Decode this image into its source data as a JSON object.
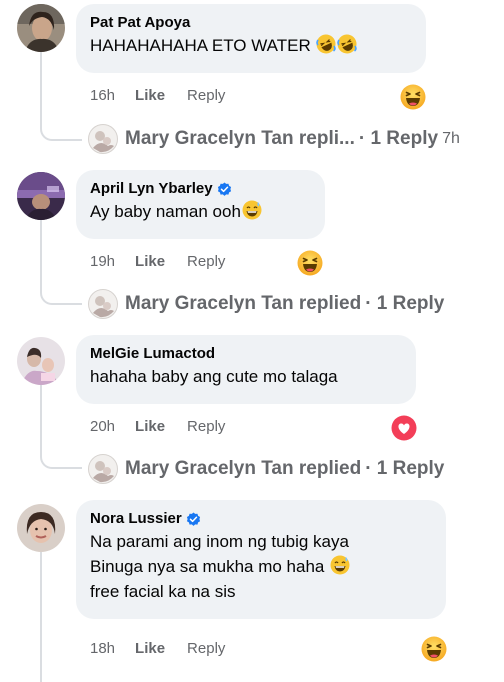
{
  "comments": [
    {
      "author": "Pat Pat Apoya",
      "verified": false,
      "lines": [
        "HAHAHAHAHA ETO WATER"
      ],
      "trailing_emojis": [
        "rofl-emoji",
        "rofl-emoji"
      ],
      "time": "16h",
      "like": "Like",
      "reply": "Reply",
      "reaction": "haha-reaction",
      "replies_text": "Mary Gracelyn Tan repli...",
      "replies_count": "· 1 Reply",
      "replies_time": "7h"
    },
    {
      "author": "April Lyn Ybarley",
      "verified": true,
      "lines": [
        "Ay baby naman ooh"
      ],
      "trailing_emojis": [
        "grin-sweat-emoji"
      ],
      "time": "19h",
      "like": "Like",
      "reply": "Reply",
      "reaction": "haha-reaction",
      "replies_text": "Mary Gracelyn Tan replied",
      "replies_count": "· 1 Reply"
    },
    {
      "author": "MelGie Lumactod",
      "verified": false,
      "lines": [
        "hahaha baby ang cute mo talaga"
      ],
      "trailing_emojis": [],
      "time": "20h",
      "like": "Like",
      "reply": "Reply",
      "reaction": "love-reaction",
      "replies_text": "Mary Gracelyn Tan replied",
      "replies_count": "· 1 Reply"
    },
    {
      "author": "Nora Lussier",
      "verified": true,
      "lines": [
        "Na parami ang inom ng tubig kaya",
        "Binuga nya sa mukha mo haha",
        "free facial ka na sis"
      ],
      "trailing_emojis": [
        "grin-sweat-emoji"
      ],
      "time": "18h",
      "like": "Like",
      "reply": "Reply",
      "reaction": "haha-reaction"
    }
  ],
  "colors": {
    "bubble": "#eff2f5",
    "meta_text": "#65676b",
    "verified": "#1877f2",
    "thread_line": "#dadde1",
    "love": "#f33e58",
    "haha": "#f7b125"
  }
}
